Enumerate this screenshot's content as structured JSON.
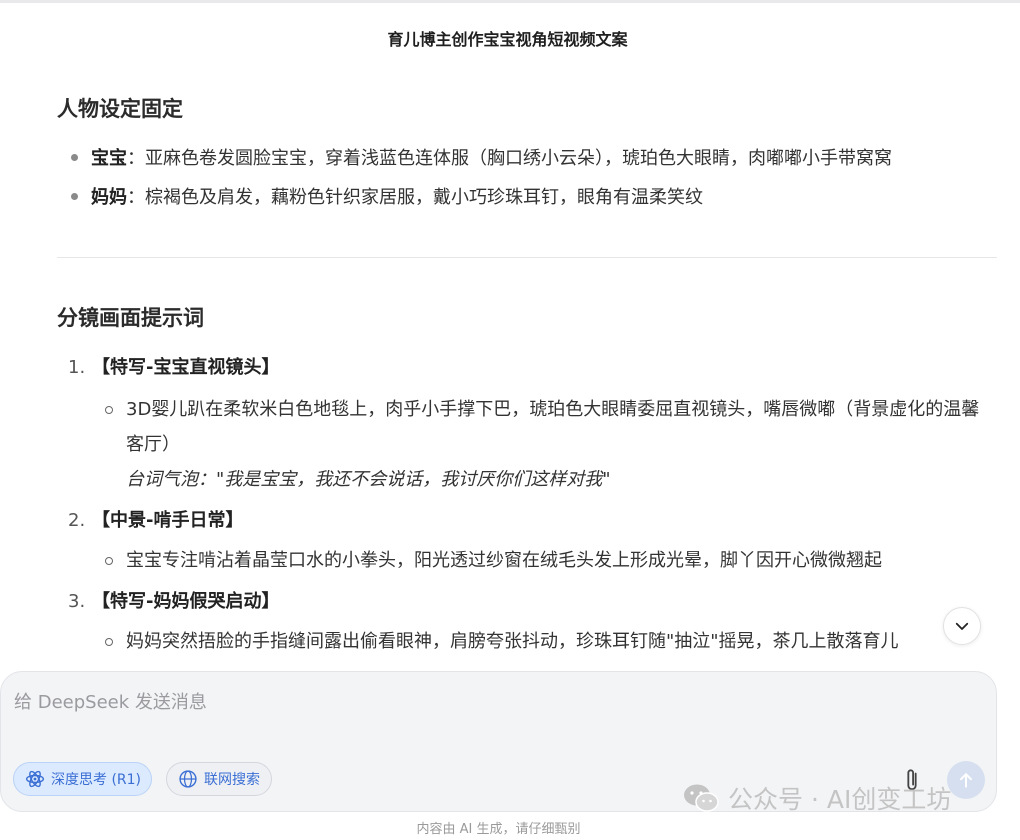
{
  "conversation": {
    "title": "育儿博主创作宝宝视角短视频文案"
  },
  "message": {
    "section_characters": {
      "heading": "人物设定固定",
      "items": [
        {
          "label": "宝宝",
          "text": "：亚麻色卷发圆脸宝宝，穿着浅蓝色连体服（胸口绣小云朵），琥珀色大眼睛，肉嘟嘟小手带窝窝"
        },
        {
          "label": "妈妈",
          "text": "：棕褐色及肩发，藕粉色针织家居服，戴小巧珍珠耳钉，眼角有温柔笑纹"
        }
      ]
    },
    "section_shots": {
      "heading": "分镜画面提示词",
      "items": [
        {
          "number": "1.",
          "label": "【特写-宝宝直视镜头】",
          "description": "3D婴儿趴在柔软米白色地毯上，肉乎小手撑下巴，琥珀色大眼睛委屈直视镜头，嘴唇微嘟（背景虚化的温馨客厅）",
          "quote": "台词气泡：\"我是宝宝，我还不会说话，我讨厌你们这样对我\""
        },
        {
          "number": "2.",
          "label": "【中景-啃手日常】",
          "description": "宝宝专注啃沾着晶莹口水的小拳头，阳光透过纱窗在绒毛头发上形成光晕，脚丫因开心微微翘起"
        },
        {
          "number": "3.",
          "label": "【特写-妈妈假哭启动】",
          "description": "妈妈突然捂脸的手指缝间露出偷看眼神，肩膀夸张抖动，珍珠耳钉随\"抽泣\"摇晃，茶几上散落育儿"
        }
      ]
    }
  },
  "composer": {
    "placeholder": "给 DeepSeek 发送消息",
    "deep_think_label": "深度思考 (R1)",
    "web_search_label": "联网搜索"
  },
  "watermark": {
    "text": "公众号 · AI创变工坊"
  },
  "footer": {
    "disclaimer": "内容由 AI 生成，请仔细甄别"
  },
  "colors": {
    "accent": "#3b6fd4",
    "chip_active_bg": "#dbeafe",
    "composer_bg": "#f3f4f6",
    "send_button_bg": "#d6dff0"
  },
  "icons": {
    "scroll_down": "chevron-down-icon",
    "deep_think": "atom-icon",
    "web_search": "globe-icon",
    "attach": "paperclip-icon",
    "send": "arrow-up-icon",
    "watermark": "wechat-icon"
  }
}
